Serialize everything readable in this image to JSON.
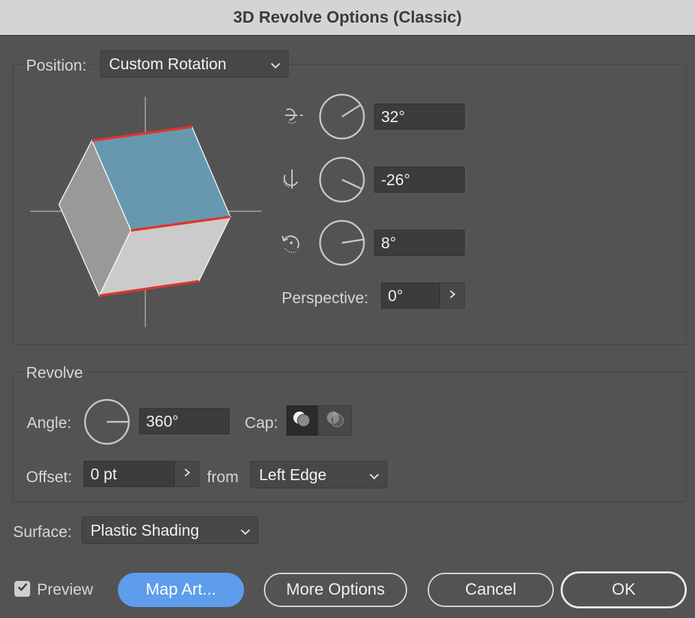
{
  "dialog": {
    "title": "3D Revolve Options (Classic)"
  },
  "position": {
    "label": "Position:",
    "selected": "Custom Rotation",
    "x_rotation": "32°",
    "y_rotation": "-26°",
    "z_rotation": "8°",
    "perspective_label": "Perspective:",
    "perspective_value": "0°"
  },
  "revolve": {
    "group_label": "Revolve",
    "angle_label": "Angle:",
    "angle_value": "360°",
    "cap_label": "Cap:",
    "offset_label": "Offset:",
    "offset_value": "0 pt",
    "from_label": "from",
    "from_selected": "Left Edge"
  },
  "surface": {
    "label": "Surface:",
    "selected": "Plastic Shading"
  },
  "footer": {
    "preview_label": "Preview",
    "preview_checked": true,
    "map_art": "Map Art...",
    "more_options": "More Options",
    "cancel": "Cancel",
    "ok": "OK"
  },
  "colors": {
    "cube_top": "#6699b0",
    "cube_left": "#999999",
    "cube_front": "#cbcbcb",
    "edge_highlight": "#e0352b",
    "primary_button": "#5e9cec"
  },
  "icons": [
    "chevron-down-icon",
    "rotate-x-icon",
    "rotate-y-icon",
    "rotate-z-icon",
    "chevron-right-icon",
    "cap-on-icon",
    "cap-off-icon",
    "checkbox-check-icon"
  ]
}
